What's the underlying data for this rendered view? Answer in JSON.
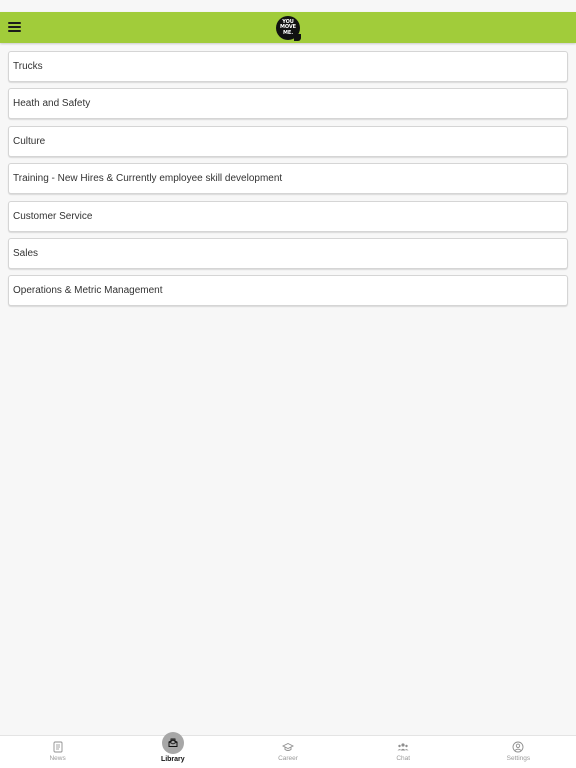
{
  "header": {
    "menu_icon": "hamburger-menu-icon",
    "logo_lines": [
      "YOU",
      "MOVE",
      "ME."
    ],
    "colors": {
      "header_bg": "#a1cc3a",
      "page_bg": "#f7f7f7",
      "active_tab_bg": "#a7a7a7"
    }
  },
  "categories": [
    "Trucks",
    "Heath and Safety",
    "Culture",
    "Training - New Hires & Currently employee skill development",
    "Customer Service",
    "Sales",
    "Operations & Metric Management"
  ],
  "tabs": [
    {
      "label": "News",
      "icon": "news-icon",
      "active": false
    },
    {
      "label": "Library",
      "icon": "library-icon",
      "active": true
    },
    {
      "label": "Career",
      "icon": "graduation-cap-icon",
      "active": false
    },
    {
      "label": "Chat",
      "icon": "group-icon",
      "active": false
    },
    {
      "label": "Settings",
      "icon": "user-circle-icon",
      "active": false
    }
  ]
}
